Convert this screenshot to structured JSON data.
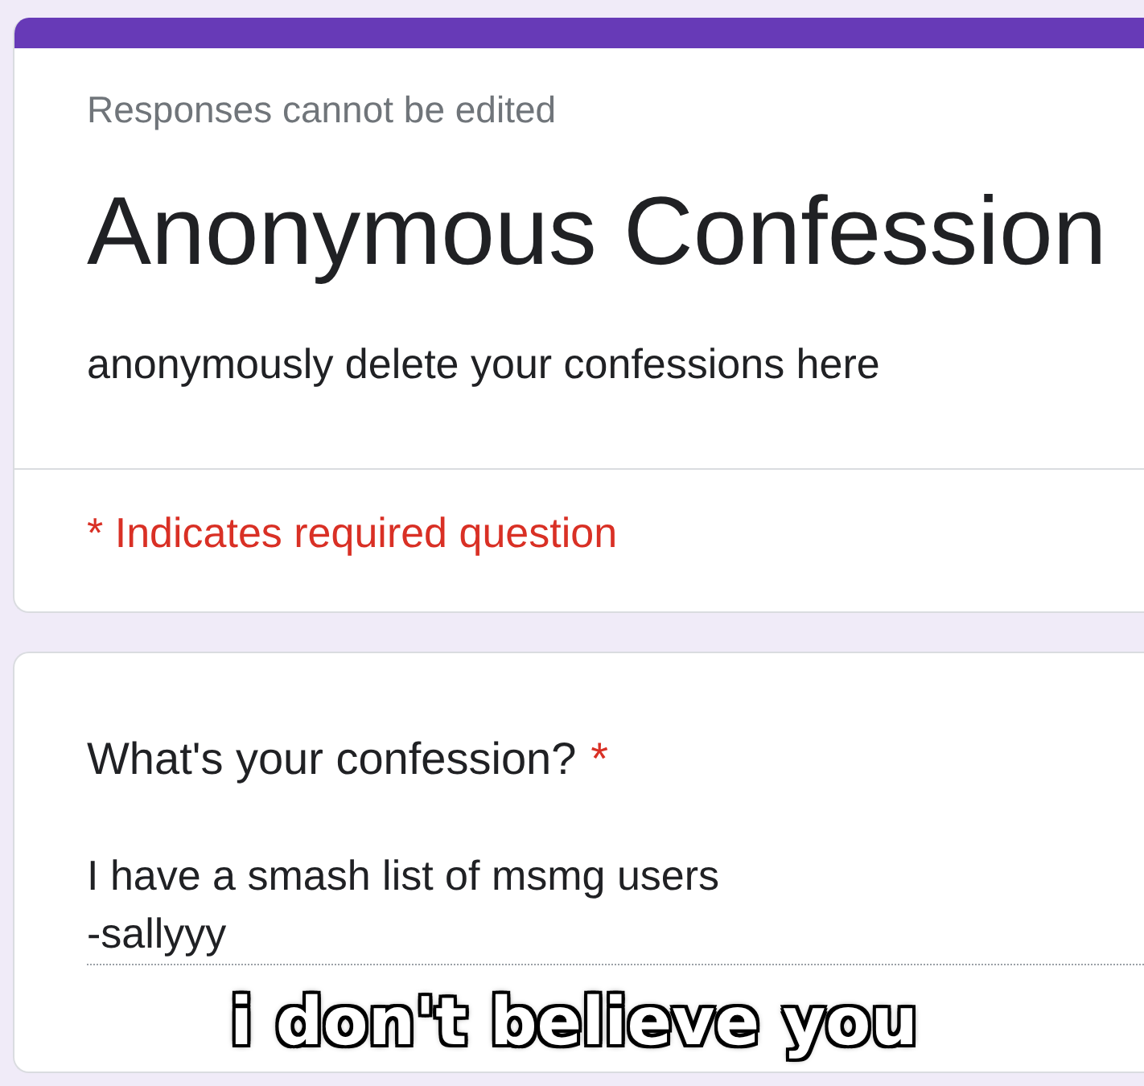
{
  "header_card": {
    "notice": "Responses cannot be edited",
    "title": "Anonymous Confession",
    "description": "anonymously delete your confessions here",
    "required_note": "* Indicates required question"
  },
  "questions": [
    {
      "label": "What's your confession?",
      "required": true,
      "required_mark": "*",
      "answer": "I have a smash list of msmg users\n-sallyyy"
    }
  ],
  "caption": "i don't believe you"
}
